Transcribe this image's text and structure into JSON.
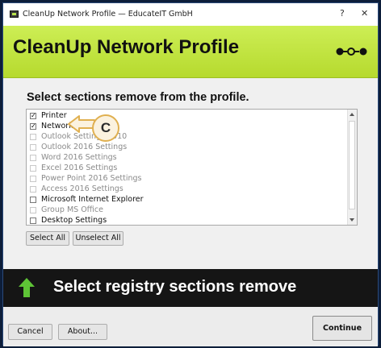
{
  "window": {
    "title": "CleanUp Network Profile — EducateIT GmbH",
    "help_label": "?",
    "close_label": "✕"
  },
  "header": {
    "title": "CleanUp Network Profile",
    "icon": "key-icon"
  },
  "section": {
    "instruction": "Select sections remove from the profile."
  },
  "list": {
    "items": [
      {
        "label": "Printer",
        "checked": true,
        "enabled": true
      },
      {
        "label": "Network",
        "checked": true,
        "enabled": true
      },
      {
        "label": "Outlook Settings 2010",
        "checked": false,
        "enabled": false
      },
      {
        "label": "Outlook 2016 Settings",
        "checked": false,
        "enabled": false
      },
      {
        "label": "Word 2016 Settings",
        "checked": false,
        "enabled": false
      },
      {
        "label": "Excel 2016 Settings",
        "checked": false,
        "enabled": false
      },
      {
        "label": "Power Point 2016 Settings",
        "checked": false,
        "enabled": false
      },
      {
        "label": "Access 2016 Settings",
        "checked": false,
        "enabled": false
      },
      {
        "label": "Microsoft Internet Explorer",
        "checked": false,
        "enabled": true
      },
      {
        "label": "Group MS Office",
        "checked": false,
        "enabled": false
      },
      {
        "label": "Desktop Settings",
        "checked": false,
        "enabled": true
      }
    ]
  },
  "buttons": {
    "select_all": "Select All",
    "unselect_all": "Unselect All",
    "cancel": "Cancel",
    "about": "About...",
    "continue": "Continue"
  },
  "callout": {
    "label": "C",
    "color": "#e0b050"
  },
  "banner": {
    "text": "Select registry sections remove",
    "icon": "green-up-arrow-icon"
  },
  "colors": {
    "header_green": "#c4e842",
    "banner_bg": "#151515",
    "arrow_green": "#5ec436",
    "callout_gold": "#e0b050"
  }
}
